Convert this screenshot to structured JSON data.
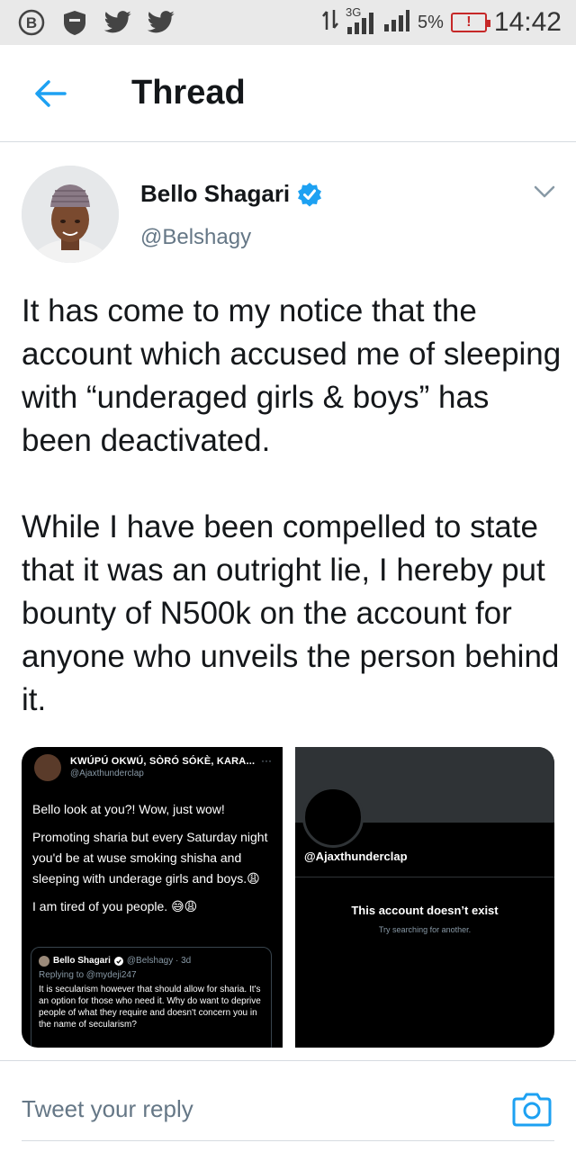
{
  "status_bar": {
    "signal_label": "3G",
    "battery_percent": "5%",
    "time": "14:42"
  },
  "header": {
    "title": "Thread",
    "back_icon": "arrow-left-icon"
  },
  "tweet": {
    "author_name": "Bello Shagari",
    "author_handle": "@Belshagy",
    "paragraphs": [
      "It has come to my notice that the account which accused me of sleeping with “underaged girls & boys” has been deactivated.",
      "While I have been compelled to state that it was an outright lie, I hereby put bounty of N500k on the account for anyone who unveils the person behind it."
    ]
  },
  "media_left": {
    "name": "KWÚPÚ OKWÚ, SÒRÓ SÓKÈ, KARA...",
    "more": "···",
    "handle": "@Ajaxthunderclap",
    "body_lines": [
      "Bello look at you?! Wow, just wow!",
      "Promoting sharia but every Saturday night you'd be at wuse smoking shisha and sleeping with underage girls and boys.😩",
      "I am tired of you people. 😅😩"
    ],
    "quote": {
      "name": "Bello Shagari",
      "meta": "@Belshagy · 3d",
      "reply": "Replying to @mydeji247",
      "text": "It is secularism however that should allow for sharia. It's an option for those who need it. Why do want to deprive people of what they require and doesn't concern you in the name of secularism?"
    }
  },
  "media_right": {
    "handle": "@Ajaxthunderclap",
    "message": "This account doesn’t exist",
    "sub": "Try searching for another."
  },
  "reply_bar": {
    "placeholder": "Tweet your reply",
    "camera_icon": "camera-icon"
  },
  "colors": {
    "accent": "#1da1f2",
    "text": "#14171a",
    "secondary": "#657786",
    "divider": "#d6dbe0"
  }
}
